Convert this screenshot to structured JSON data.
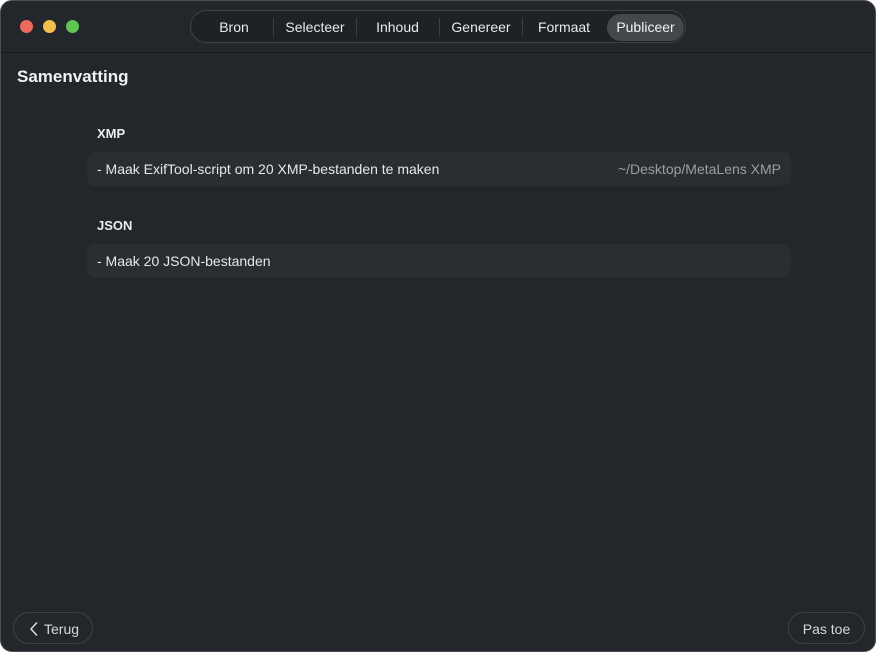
{
  "tabs": [
    {
      "label": "Bron",
      "active": false
    },
    {
      "label": "Selecteer",
      "active": false
    },
    {
      "label": "Inhoud",
      "active": false
    },
    {
      "label": "Genereer",
      "active": false
    },
    {
      "label": "Formaat",
      "active": false
    },
    {
      "label": "Publiceer",
      "active": true
    }
  ],
  "page": {
    "title": "Samenvatting"
  },
  "sections": [
    {
      "title": "XMP",
      "description": "- Maak ExifTool-script om 20 XMP-bestanden te maken",
      "path": "~/Desktop/MetaLens XMP"
    },
    {
      "title": "JSON",
      "description": "- Maak 20 JSON-bestanden"
    }
  ],
  "footer": {
    "back_label": "Terug",
    "apply_label": "Pas toe"
  },
  "colors": {
    "window_background": "#23262a",
    "row_background": "#2a2d31",
    "active_tab": "#44474c",
    "traffic_close": "#ed6a5e",
    "traffic_minimize": "#f5bf4f",
    "traffic_zoom": "#61c554"
  },
  "icons": {
    "back": "chevron-left-icon"
  }
}
